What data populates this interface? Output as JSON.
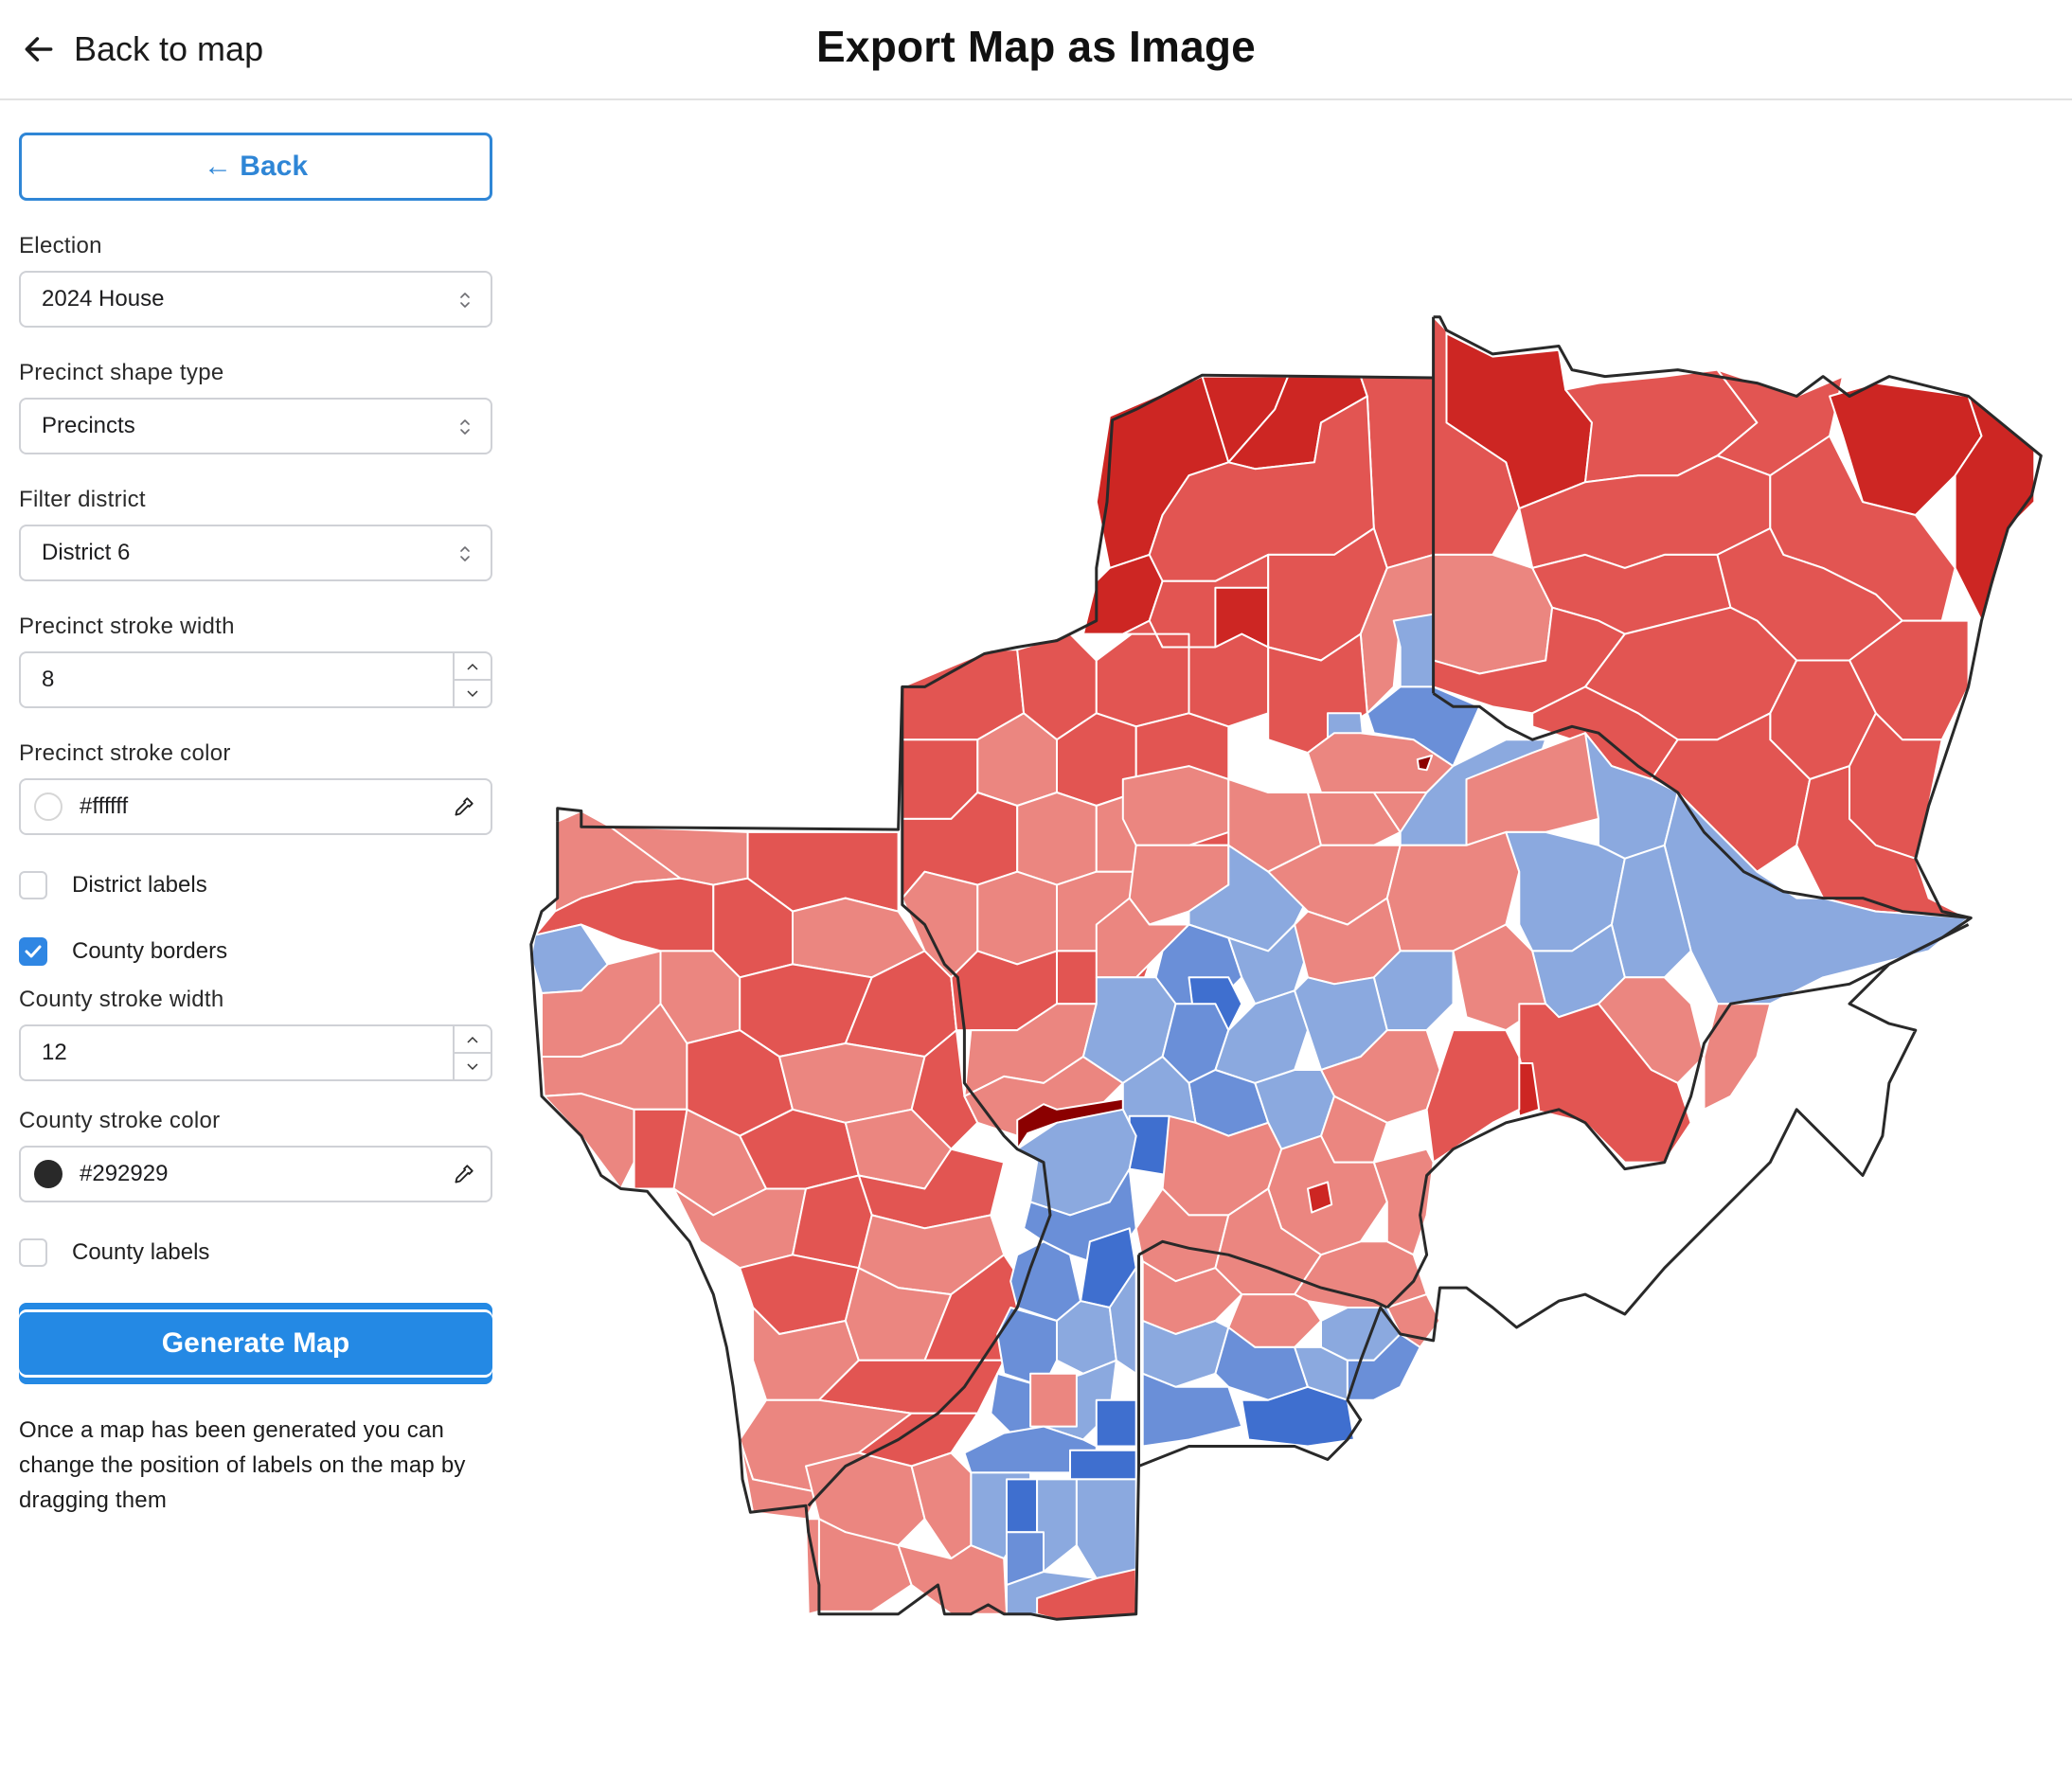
{
  "header": {
    "back_label": "Back to map",
    "title": "Export Map as Image"
  },
  "sidebar": {
    "back_button": "← Back",
    "election": {
      "label": "Election",
      "value": "2024 House"
    },
    "shape_type": {
      "label": "Precinct shape type",
      "value": "Precincts"
    },
    "district": {
      "label": "Filter district",
      "value": "District 6"
    },
    "precinct_stroke_width": {
      "label": "Precinct stroke width",
      "value": "8"
    },
    "precinct_stroke_color": {
      "label": "Precinct stroke color",
      "value": "#ffffff"
    },
    "district_labels": {
      "label": "District labels",
      "checked": false
    },
    "county_borders": {
      "label": "County borders",
      "checked": true
    },
    "county_stroke_width": {
      "label": "County stroke width",
      "value": "12"
    },
    "county_stroke_color": {
      "label": "County stroke color",
      "value": "#292929"
    },
    "county_labels": {
      "label": "County labels",
      "checked": false
    },
    "generate_button": "Generate Map",
    "help_text": "Once a map has been generated you can change the position of labels on the map by dragging them"
  },
  "map": {
    "precinct_stroke": "#ffffff",
    "county_stroke": "#292929",
    "palette": {
      "r4": "#8b0000",
      "r3": "#cd2623",
      "r2": "#e25552",
      "r1": "#eb8680",
      "d1": "#8ba9df",
      "d2": "#6a8fd8",
      "d3": "#3f6fcf",
      "d4": "#2b55b0"
    },
    "accent": "#2f86e3"
  }
}
